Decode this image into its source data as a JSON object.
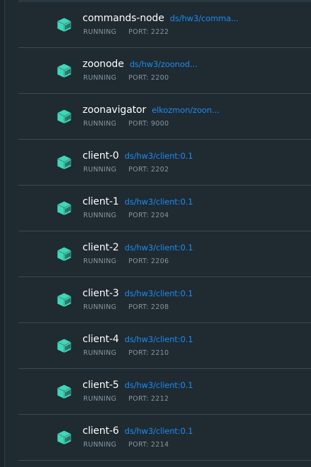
{
  "containers": [
    {
      "name": "commands-node",
      "image": "ds/hw3/comma...",
      "status": "RUNNING",
      "port": "PORT: 2222",
      "icon": "container-icon"
    },
    {
      "name": "zoonode",
      "image": "ds/hw3/zoonod...",
      "status": "RUNNING",
      "port": "PORT: 2200",
      "icon": "container-icon"
    },
    {
      "name": "zoonavigator",
      "image": "elkozmon/zoon...",
      "status": "RUNNING",
      "port": "PORT: 9000",
      "icon": "container-icon"
    },
    {
      "name": "client-0",
      "image": "ds/hw3/client:0.1",
      "status": "RUNNING",
      "port": "PORT: 2202",
      "icon": "container-icon"
    },
    {
      "name": "client-1",
      "image": "ds/hw3/client:0.1",
      "status": "RUNNING",
      "port": "PORT: 2204",
      "icon": "container-icon"
    },
    {
      "name": "client-2",
      "image": "ds/hw3/client:0.1",
      "status": "RUNNING",
      "port": "PORT: 2206",
      "icon": "container-icon"
    },
    {
      "name": "client-3",
      "image": "ds/hw3/client:0.1",
      "status": "RUNNING",
      "port": "PORT: 2208",
      "icon": "container-icon"
    },
    {
      "name": "client-4",
      "image": "ds/hw3/client:0.1",
      "status": "RUNNING",
      "port": "PORT: 2210",
      "icon": "container-icon"
    },
    {
      "name": "client-5",
      "image": "ds/hw3/client:0.1",
      "status": "RUNNING",
      "port": "PORT: 2212",
      "icon": "container-icon"
    },
    {
      "name": "client-6",
      "image": "ds/hw3/client:0.1",
      "status": "RUNNING",
      "port": "PORT: 2214",
      "icon": "container-icon"
    }
  ],
  "colors": {
    "background": "#1f2a31",
    "icon": "#3fd7b8",
    "image_link": "#1d8cf0",
    "name": "#ffffff",
    "meta": "#8a979f",
    "divider": "#394a55"
  }
}
